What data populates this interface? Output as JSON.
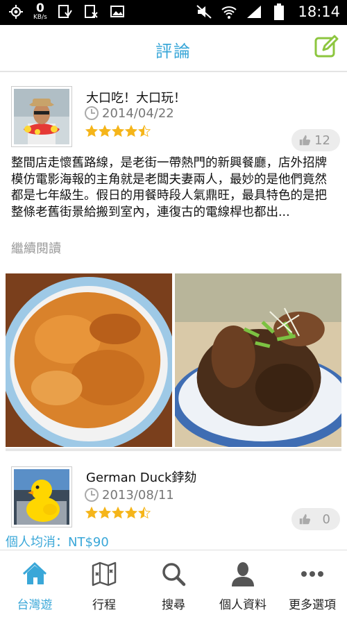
{
  "status_bar": {
    "speed_value": "0",
    "speed_unit": "KB/s",
    "time": "18:14"
  },
  "header": {
    "title": "評論",
    "edit_icon": "edit-icon"
  },
  "reviews": [
    {
      "name": "大口吃！大口玩！",
      "date": "2014/04/22",
      "rating": 4.5,
      "likes": "12",
      "body": "整間店走懷舊路線，是老街一帶熱門的新興餐廳，店外招牌模仿電影海報的主角就是老闆夫妻兩人，最妙的是他們竟然都是七年級生。假日的用餐時段人氣鼎旺，最具特色的是把整條老舊街景給搬到室內，連復古的電線桿也都出...",
      "read_more": "繼續閱讀"
    },
    {
      "name": "German Duck鋍劾",
      "date": "2013/08/11",
      "rating": 4.5,
      "likes": "0",
      "avg_price": "個人均消：NT$90"
    }
  ],
  "tabs": [
    {
      "label": "台灣遊",
      "icon": "home-icon",
      "active": true
    },
    {
      "label": "行程",
      "icon": "map-icon",
      "active": false
    },
    {
      "label": "搜尋",
      "icon": "search-icon",
      "active": false
    },
    {
      "label": "個人資料",
      "icon": "person-icon",
      "active": false
    },
    {
      "label": "更多選項",
      "icon": "more-icon",
      "active": false
    }
  ],
  "colors": {
    "accent": "#3aa7d8",
    "edit_green": "#8dc63f",
    "star": "#f5b51a"
  }
}
